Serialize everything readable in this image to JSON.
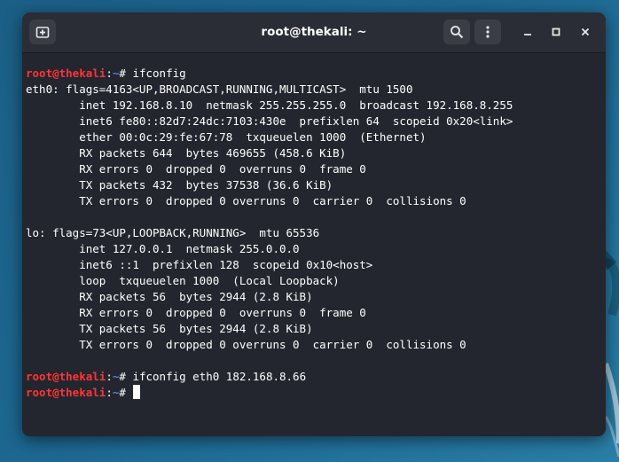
{
  "window": {
    "title": "root@thekali: ~"
  },
  "toolbar": {
    "new_tab_icon": "new-tab-icon",
    "search_icon": "search-icon",
    "menu_icon": "kebab-menu-icon",
    "minimize_icon": "minimize-icon",
    "maximize_icon": "maximize-icon",
    "close_icon": "close-icon"
  },
  "prompt": {
    "user": "root@thekali",
    "colon": ":",
    "path": "~",
    "symbol": "# "
  },
  "colors": {
    "prompt_user": "#ff3434",
    "prompt_path": "#4d83d8",
    "terminal_bg": "#23262e",
    "text": "#ffffff"
  },
  "terminal": {
    "lines": [
      {
        "type": "prompt",
        "command": "ifconfig"
      },
      {
        "type": "output",
        "text": "eth0: flags=4163<UP,BROADCAST,RUNNING,MULTICAST>  mtu 1500"
      },
      {
        "type": "output",
        "text": "        inet 192.168.8.10  netmask 255.255.255.0  broadcast 192.168.8.255"
      },
      {
        "type": "output",
        "text": "        inet6 fe80::82d7:24dc:7103:430e  prefixlen 64  scopeid 0x20<link>"
      },
      {
        "type": "output",
        "text": "        ether 00:0c:29:fe:67:78  txqueuelen 1000  (Ethernet)"
      },
      {
        "type": "output",
        "text": "        RX packets 644  bytes 469655 (458.6 KiB)"
      },
      {
        "type": "output",
        "text": "        RX errors 0  dropped 0  overruns 0  frame 0"
      },
      {
        "type": "output",
        "text": "        TX packets 432  bytes 37538 (36.6 KiB)"
      },
      {
        "type": "output",
        "text": "        TX errors 0  dropped 0 overruns 0  carrier 0  collisions 0"
      },
      {
        "type": "output",
        "text": ""
      },
      {
        "type": "output",
        "text": "lo: flags=73<UP,LOOPBACK,RUNNING>  mtu 65536"
      },
      {
        "type": "output",
        "text": "        inet 127.0.0.1  netmask 255.0.0.0"
      },
      {
        "type": "output",
        "text": "        inet6 ::1  prefixlen 128  scopeid 0x10<host>"
      },
      {
        "type": "output",
        "text": "        loop  txqueuelen 1000  (Local Loopback)"
      },
      {
        "type": "output",
        "text": "        RX packets 56  bytes 2944 (2.8 KiB)"
      },
      {
        "type": "output",
        "text": "        RX errors 0  dropped 0  overruns 0  frame 0"
      },
      {
        "type": "output",
        "text": "        TX packets 56  bytes 2944 (2.8 KiB)"
      },
      {
        "type": "output",
        "text": "        TX errors 0  dropped 0 overruns 0  carrier 0  collisions 0"
      },
      {
        "type": "output",
        "text": ""
      },
      {
        "type": "prompt",
        "command": "ifconfig eth0 182.168.8.66"
      },
      {
        "type": "prompt",
        "command": "",
        "cursor": true
      }
    ]
  }
}
